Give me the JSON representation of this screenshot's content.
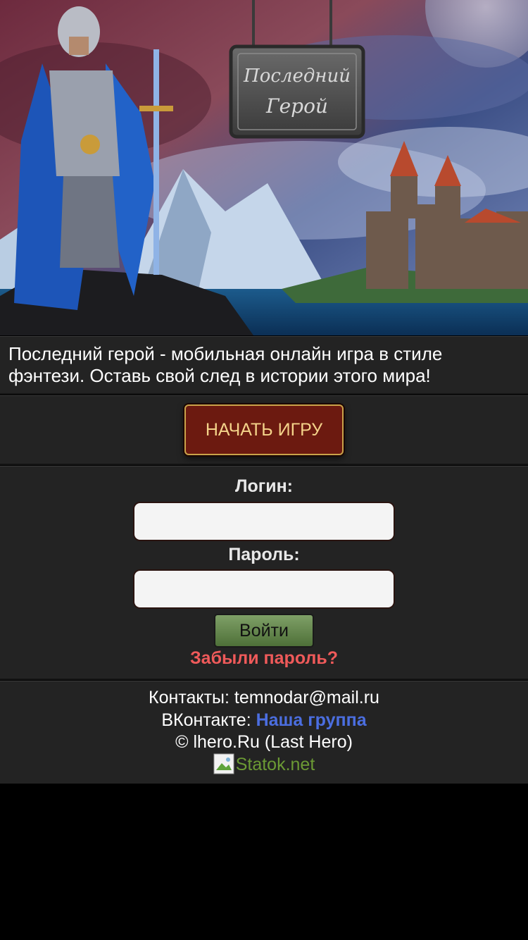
{
  "hero": {
    "sign_line1": "Последний",
    "sign_line2": "Герой"
  },
  "description": "Последний герой - мобильная онлайн игра в стиле фэнтези. Оставь свой след в истории этого мира!",
  "start_button": "НАЧАТЬ ИГРУ",
  "login": {
    "login_label": "Логин:",
    "login_value": "",
    "password_label": "Пароль:",
    "password_value": "",
    "submit_label": "Войти",
    "forgot_label": "Забыли пароль?"
  },
  "footer": {
    "contacts_prefix": "Контакты: ",
    "email": "temnodar@mail.ru",
    "vk_prefix": "ВКонтакте: ",
    "vk_link": "Наша группа",
    "copyright": "© lhero.Ru (Last Hero)",
    "counter_alt": "Statok.net"
  },
  "colors": {
    "panel_bg": "#232323",
    "start_button_bg": "#6c1a10",
    "start_button_text": "#f4d38a",
    "forgot_link": "#ef5a5a",
    "vk_link": "#4b6ee0",
    "counter_link": "#6b9a34"
  }
}
